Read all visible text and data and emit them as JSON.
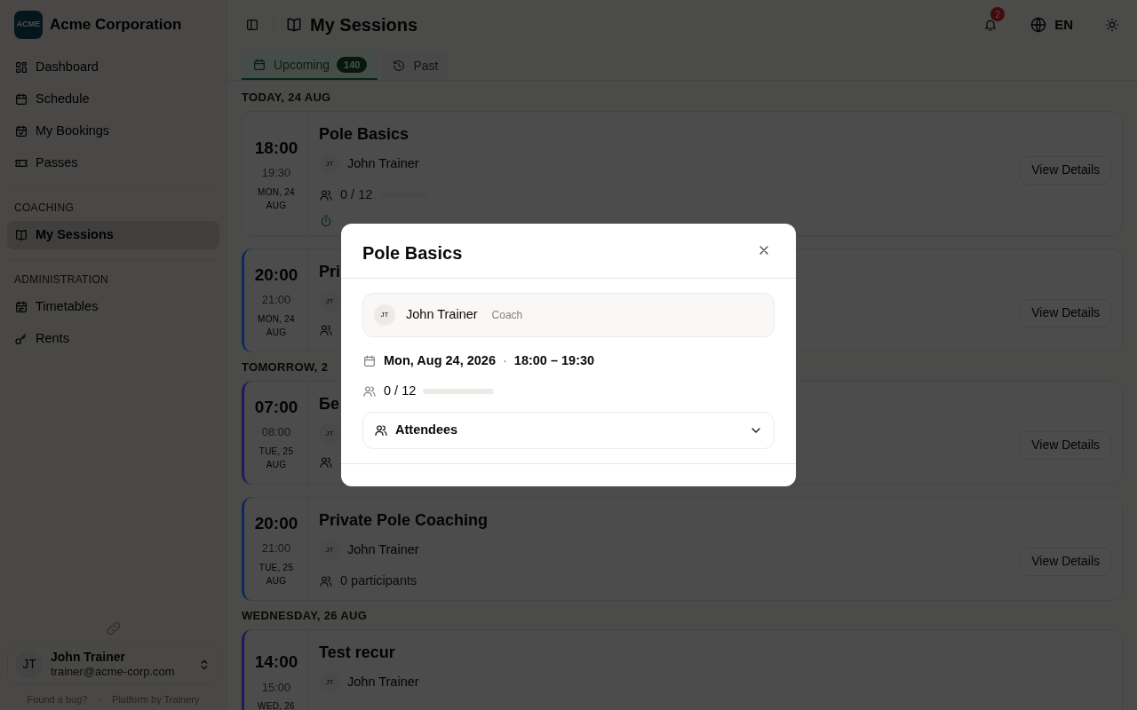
{
  "sidebar": {
    "brand": {
      "logo_text": "ACME",
      "name": "Acme Corporation"
    },
    "nav_groups": [
      {
        "items": [
          {
            "label": "Dashboard",
            "selected": false
          },
          {
            "label": "Schedule",
            "selected": false
          },
          {
            "label": "My Bookings",
            "selected": false
          },
          {
            "label": "Passes",
            "selected": false
          }
        ]
      },
      {
        "heading": "COACHING",
        "items": [
          {
            "label": "My Sessions",
            "selected": true
          }
        ]
      },
      {
        "heading": "ADMINISTRATION",
        "items": [
          {
            "label": "Timetables",
            "selected": false
          },
          {
            "label": "Rents",
            "selected": false
          }
        ]
      }
    ],
    "user": {
      "initials": "JT",
      "name": "John Trainer",
      "email": "trainer@acme-corp.com"
    },
    "footer_links": [
      "Found a bug?",
      "Platform by Trainery"
    ],
    "footer_separator": "·"
  },
  "header": {
    "title": "My Sessions",
    "notification_count": "2",
    "language": "EN"
  },
  "tabs": [
    {
      "label": "Upcoming",
      "count": "140",
      "selected": true
    },
    {
      "label": "Past",
      "selected": false
    }
  ],
  "days": [
    {
      "heading": "TODAY, 24 AUG",
      "sessions": [
        {
          "start": "18:00",
          "end": "19:30",
          "date": "MON, 24 AUG",
          "title": "Pole Basics",
          "coach_initials": "JT",
          "coach": "John Trainer",
          "participants": {
            "kind": "capacity",
            "text": "0 / 12",
            "level": 0
          },
          "status": {
            "kind": "in_progress"
          },
          "action": "View Details"
        },
        {
          "start": "20:00",
          "end": "21:00",
          "date": "MON, 24 AUG",
          "color": "#0c2a5c",
          "title": "Pri",
          "coach_initials": "JT",
          "participants": {
            "kind": "covered"
          },
          "action": "View Details"
        }
      ]
    },
    {
      "heading": "TOMORROW, 2",
      "sessions": [
        {
          "start": "07:00",
          "end": "08:00",
          "date": "TUE, 25 AUG",
          "color": "#1e1b5e",
          "title": "Бе",
          "coach_initials": "JT",
          "participants": {
            "kind": "covered"
          },
          "action": "View Details"
        },
        {
          "start": "20:00",
          "end": "21:00",
          "date": "TUE, 25 AUG",
          "color": "#0c2a5c",
          "title": "Private Pole Coaching",
          "coach_initials": "JT",
          "coach": "John Trainer",
          "participants": {
            "kind": "count",
            "text": "0 participants"
          },
          "action": "View Details"
        }
      ]
    },
    {
      "heading": "WEDNESDAY, 26 AUG",
      "sessions": [
        {
          "start": "14:00",
          "end": "15:00",
          "date": "WED, 26",
          "color": "#1e1b5e",
          "title": "Test recur",
          "coach_initials": "JT",
          "coach": "John Trainer"
        }
      ]
    }
  ],
  "modal": {
    "title": "Pole Basics",
    "coach": {
      "initials": "JT",
      "name": "John Trainer",
      "role": "Coach"
    },
    "date": "Mon, Aug 24, 2026",
    "separator": "·",
    "time": "18:00 – 19:30",
    "capacity": "0 / 12",
    "level": 0,
    "attendees": {
      "label": "Attendees",
      "expanded": false
    }
  }
}
